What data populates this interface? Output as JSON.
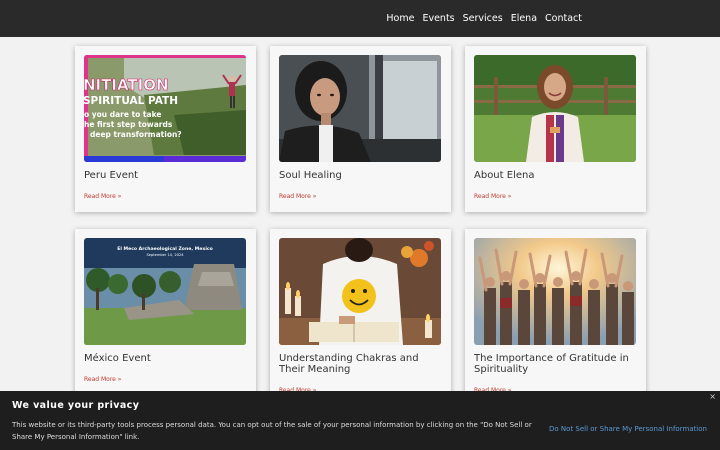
{
  "nav": {
    "items": [
      "Home",
      "Events",
      "Services",
      "Elena",
      "Contact"
    ]
  },
  "cards": [
    {
      "title": "Peru Event",
      "read_more": "Read More »",
      "image": {
        "overlay_lines": [
          "NITIATION",
          "SPIRITUAL PATH",
          "o you dare to take",
          "he first step towards",
          "deep transformation?"
        ]
      }
    },
    {
      "title": "Soul Healing",
      "read_more": "Read More »"
    },
    {
      "title": "About Elena",
      "read_more": "Read More »"
    },
    {
      "title": "México Event",
      "read_more": "Read More »",
      "image": {
        "overlay_lines": [
          "El Meco Archaeological Zone, Mexico",
          "September 14, 2024"
        ]
      }
    },
    {
      "title": "Understanding Chakras and Their Meaning",
      "read_more": "Read More »"
    },
    {
      "title": "The Importance of Gratitude in Spirituality",
      "read_more": "Read More »"
    }
  ],
  "cookie_banner": {
    "heading": "We value your privacy",
    "body": "This website or its third-party tools process personal data. You can opt out of the sale of your personal information by clicking on the \"Do Not Sell or Share My Personal Information\" link.",
    "link": "Do Not Sell or Share My Personal Information",
    "close": "×"
  },
  "colors": {
    "topbar": "#2a2a2a",
    "page_background": "#f2f2f2",
    "read_more": "#c0392b",
    "cookie_background": "#1e1e1e",
    "cookie_link": "#5b9bd5"
  }
}
